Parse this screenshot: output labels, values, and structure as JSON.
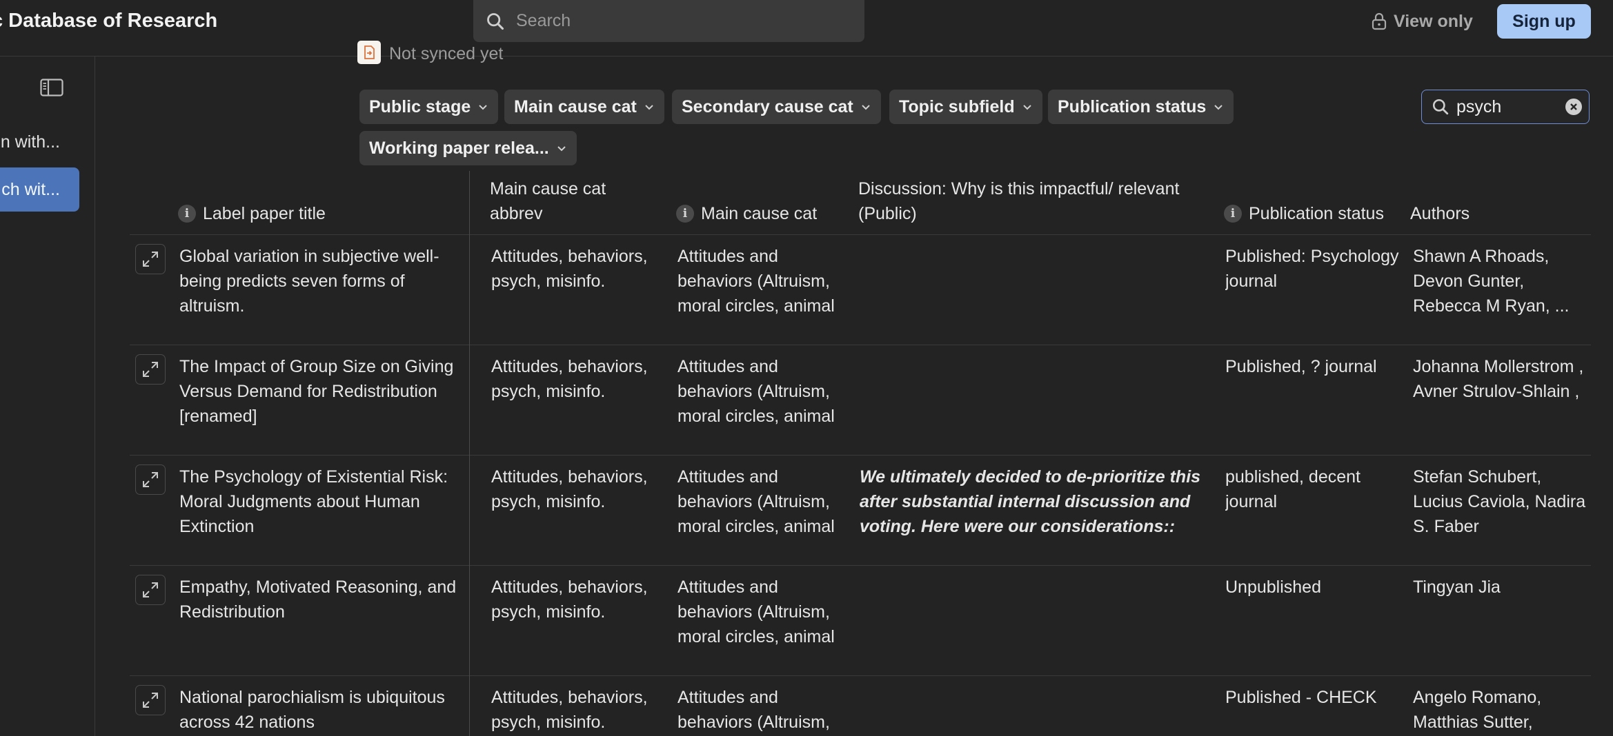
{
  "app": {
    "title": "c Database of Research"
  },
  "search": {
    "placeholder": "Search"
  },
  "header": {
    "view_only": "View only",
    "signup": "Sign up"
  },
  "sidebar": {
    "items": [
      {
        "label": "n with..."
      },
      {
        "label": "ch wit..."
      }
    ]
  },
  "sync": {
    "status": "Not synced yet"
  },
  "filters": {
    "chips": [
      {
        "label": "Public stage"
      },
      {
        "label": "Main cause cat"
      },
      {
        "label": "Secondary cause cat"
      },
      {
        "label": "Topic subfield"
      },
      {
        "label": "Publication status"
      },
      {
        "label": "Working paper relea..."
      }
    ],
    "search_value": "psych"
  },
  "table": {
    "columns": [
      {
        "label": "Label paper title"
      },
      {
        "label": "Main cause cat abbrev"
      },
      {
        "label": "Main cause cat"
      },
      {
        "label": "Discussion: Why is this impactful/ relevant (Public)"
      },
      {
        "label": "Publication status"
      },
      {
        "label": "Authors"
      }
    ],
    "rows": [
      {
        "title": "Global variation in subjective well-being predicts seven forms of altruism.",
        "abbrev": "Attitudes, behaviors, psych, misinfo.",
        "cause": "Attitudes and behaviors (Altruism, moral circles, animal",
        "discussion": "",
        "status": "Published: Psychology journal",
        "authors": "Shawn A Rhoads, Devon Gunter, Rebecca M Ryan, ..."
      },
      {
        "title": "The Impact of Group Size on Giving Versus Demand for Redistribution [renamed]",
        "abbrev": "Attitudes, behaviors, psych, misinfo.",
        "cause": "Attitudes and behaviors (Altruism, moral circles, animal",
        "discussion": "",
        "status": "Published, ? journal",
        "authors": "Johanna Mollerstrom , Avner Strulov-Shlain ,"
      },
      {
        "title": "The Psychology of Existential Risk: Moral Judgments about Human Extinction",
        "abbrev": "Attitudes, behaviors, psych, misinfo.",
        "cause": "Attitudes and behaviors (Altruism, moral circles, animal",
        "discussion": "We ultimately decided to de-prioritize this after substantial internal discussion and voting. Here were our considerations::",
        "status": "published, decent journal",
        "authors": "Stefan Schubert, Lucius Caviola, Nadira S. Faber"
      },
      {
        "title": "Empathy, Motivated Reasoning, and Redistribution",
        "abbrev": "Attitudes, behaviors, psych, misinfo.",
        "cause": "Attitudes and behaviors (Altruism, moral circles, animal",
        "discussion": "",
        "status": "Unpublished",
        "authors": "Tingyan Jia"
      },
      {
        "title": "National parochialism is ubiquitous across 42 nations",
        "abbrev": "Attitudes, behaviors, psych, misinfo.",
        "cause": "Attitudes and behaviors (Altruism,",
        "discussion": "",
        "status": "Published - CHECK",
        "authors": "Angelo Romano, Matthias Sutter,"
      }
    ]
  }
}
